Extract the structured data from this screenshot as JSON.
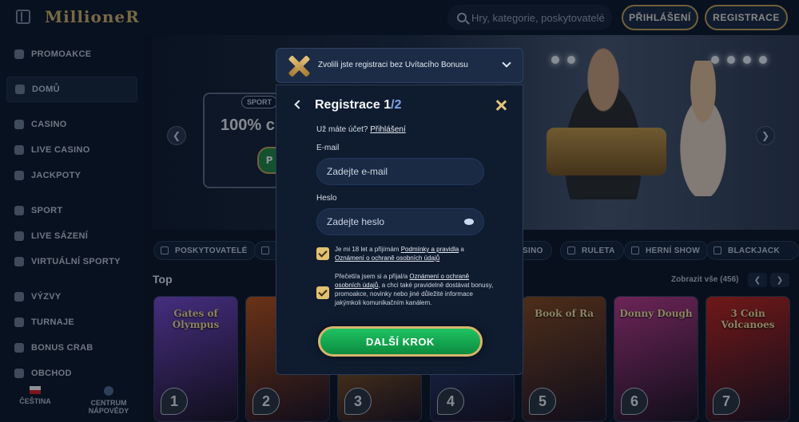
{
  "header": {
    "logo": "MillioneR",
    "search_placeholder": "Hry, kategorie, poskytovatelé",
    "login_label": "PŘIHLÁŠENÍ",
    "register_label": "REGISTRACE"
  },
  "sidebar": {
    "items": [
      {
        "label": "PROMOAKCE",
        "icon": "megaphone-icon"
      },
      {
        "label": "DOMŮ",
        "icon": "home-icon"
      },
      {
        "label": "CASINO",
        "icon": "diamond-icon"
      },
      {
        "label": "LIVE CASINO",
        "icon": "live-icon"
      },
      {
        "label": "JACKPOTY",
        "icon": "clover-icon"
      },
      {
        "label": "SPORT",
        "icon": "ball-icon"
      },
      {
        "label": "LIVE SÁZENÍ",
        "icon": "live-bet-icon"
      },
      {
        "label": "VIRTUÁLNÍ SPORTY",
        "icon": "virtual-icon"
      },
      {
        "label": "VÝZVY",
        "icon": "challenge-icon"
      },
      {
        "label": "TURNAJE",
        "icon": "trophy-icon"
      },
      {
        "label": "BONUS CRAB",
        "icon": "crab-icon"
      },
      {
        "label": "OBCHOD",
        "icon": "shop-icon"
      }
    ],
    "language": "ČEŠTINA",
    "help_line1": "CENTRUM",
    "help_line2": "NÁPOVĚDY"
  },
  "hero": {
    "badge": "SPORT",
    "headline": "100% c",
    "button_fragment": "P"
  },
  "categories": [
    "POSKYTOVATELÉ",
    "CASINO",
    "RULETA",
    "HERNÍ SHOW",
    "BLACKJACK"
  ],
  "top_section": {
    "title": "Top",
    "show_all": "Zobrazit vše (456)",
    "games": [
      {
        "rank": "1",
        "name": "Gates of Olympus",
        "color": "#7a4bd6"
      },
      {
        "rank": "2",
        "name": "",
        "color": "#c0531a"
      },
      {
        "rank": "3",
        "name": "",
        "color": "#d0821c"
      },
      {
        "rank": "4",
        "name": "",
        "color": "#2b4f9b"
      },
      {
        "rank": "5",
        "name": "Book of Ra",
        "color": "#8a4a1e"
      },
      {
        "rank": "6",
        "name": "Donny Dough",
        "color": "#c23a8f"
      },
      {
        "rank": "7",
        "name": "3 Coin Volcanoes",
        "color": "#c8241d"
      }
    ]
  },
  "modal": {
    "banner_text": "Zvolili jste registraci bez Uvítacího Bonusu",
    "title": "Registrace 1",
    "step": "/2",
    "have_account": "Už máte účet?",
    "login_link": "Přihlášení",
    "email_label": "E-mail",
    "email_placeholder": "Zadejte e-mail",
    "password_label": "Heslo",
    "password_placeholder": "Zadejte heslo",
    "check1_a": "Je mi 18 let a přijímám ",
    "check1_link1": "Podmínky a pravidla",
    "check1_b": " a ",
    "check1_link2": "Oznámení o ochraně osobních údajů",
    "check2_a": "Přečetl/a jsem si a přijal/a ",
    "check2_link": "Oznámení o ochraně osobních údajů",
    "check2_b": ", a chci také pravidelně dostávat bonusy, promoakce, novinky nebo jiné důležité informace jakýmkoli komunikačním kanálem.",
    "next_label": "DALŠÍ KROK"
  }
}
